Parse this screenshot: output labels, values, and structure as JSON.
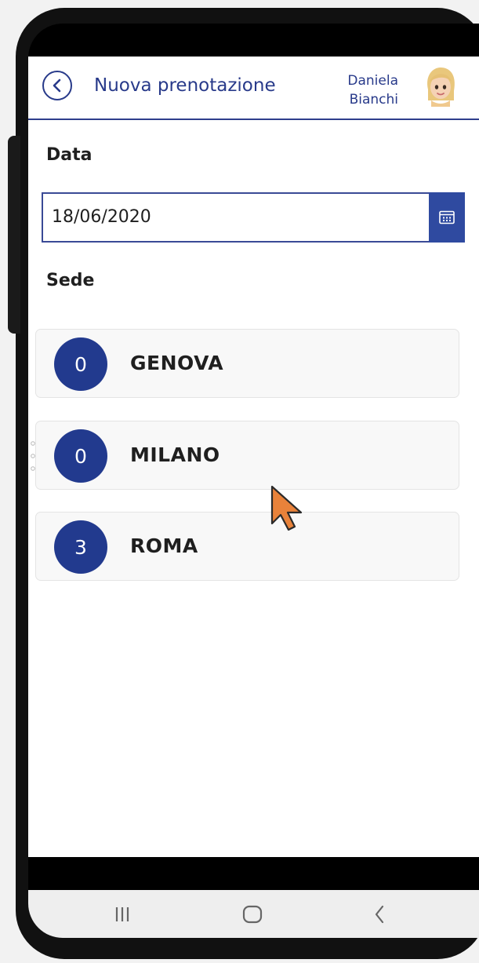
{
  "header": {
    "title": "Nuova prenotazione",
    "user_first": "Daniela",
    "user_last": "Bianchi"
  },
  "form": {
    "date_label": "Data",
    "date_value": "18/06/2020",
    "location_label": "Sede"
  },
  "locations": [
    {
      "count": "0",
      "name": "GENOVA"
    },
    {
      "count": "0",
      "name": "MILANO"
    },
    {
      "count": "3",
      "name": "ROMA"
    }
  ],
  "colors": {
    "accent": "#283a8a",
    "badge": "#223a8e",
    "cursor": "#e8823a"
  },
  "icons": {
    "back": "chevron-left-icon",
    "calendar": "calendar-icon",
    "nav_recent": "recent-apps-icon",
    "nav_home": "home-icon",
    "nav_back": "back-icon"
  }
}
